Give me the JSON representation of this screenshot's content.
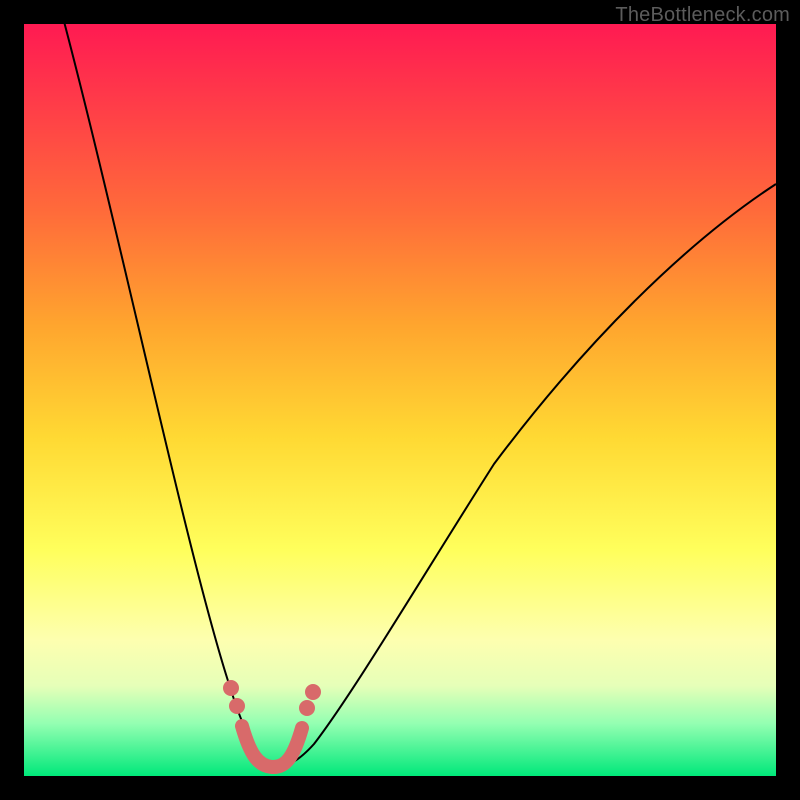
{
  "watermark": "TheBottleneck.com",
  "colors": {
    "background": "#000000",
    "gradient_top": "#ff1a52",
    "gradient_bottom": "#00e87a",
    "curve": "#000000",
    "marker": "#d86a6a"
  },
  "chart_data": {
    "type": "line",
    "title": "",
    "xlabel": "",
    "ylabel": "",
    "xlim": [
      0,
      100
    ],
    "ylim": [
      0,
      100
    ],
    "series": [
      {
        "name": "bottleneck-curve",
        "x": [
          0,
          5,
          10,
          15,
          20,
          24,
          27,
          30,
          31,
          32,
          33,
          34,
          36,
          38,
          40,
          45,
          50,
          55,
          60,
          70,
          80,
          90,
          100
        ],
        "y": [
          110,
          95,
          80,
          62,
          42,
          22,
          10,
          3,
          1,
          0,
          0,
          0,
          1,
          2,
          5,
          13,
          24,
          34,
          42,
          55,
          64,
          70,
          75
        ]
      }
    ],
    "markers": {
      "name": "optimal-range",
      "x": [
        27.5,
        29,
        30,
        31,
        33,
        35,
        36,
        37,
        38.5
      ],
      "y": [
        10,
        5,
        1,
        0,
        0,
        0,
        0.5,
        3,
        8
      ]
    }
  }
}
